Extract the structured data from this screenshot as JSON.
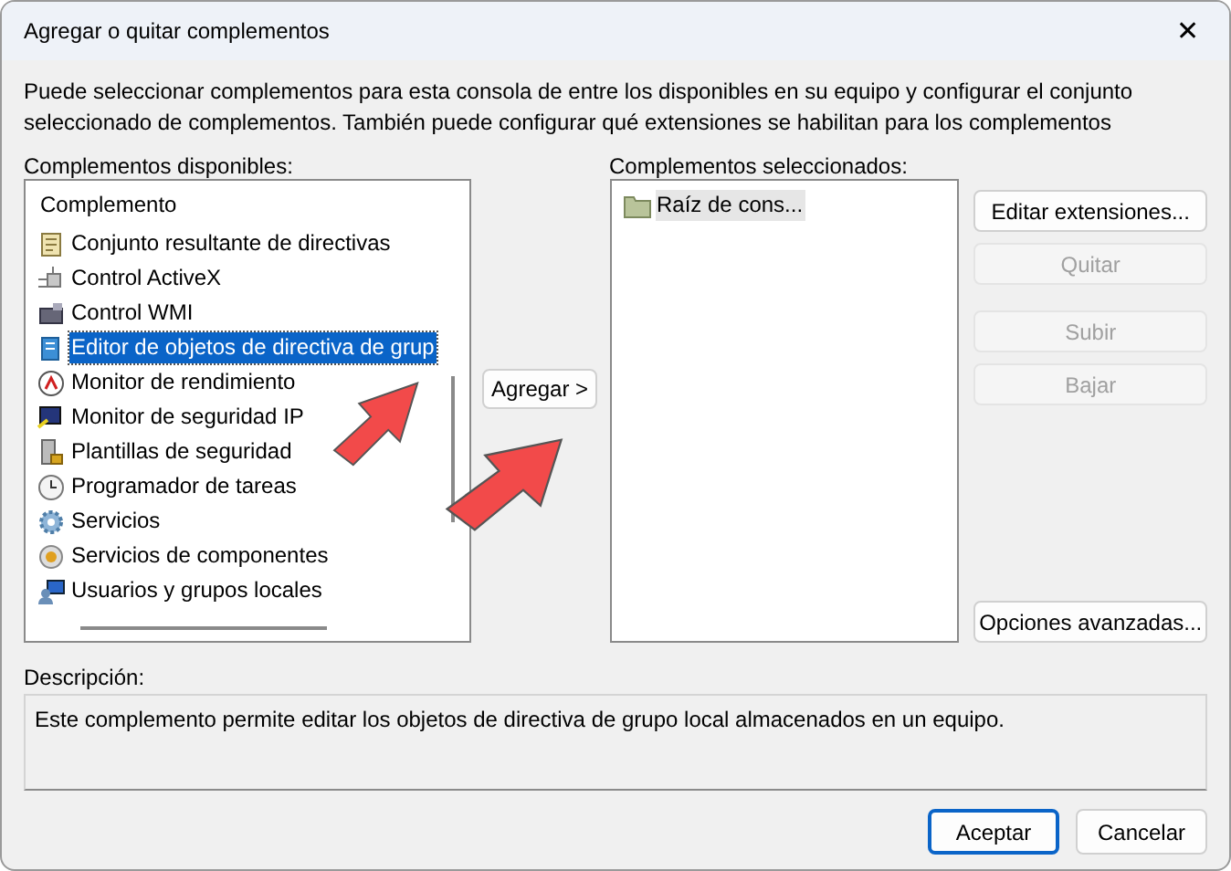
{
  "window": {
    "title": "Agregar o quitar complementos",
    "close": "✕"
  },
  "intro": "Puede seleccionar complementos para esta consola de entre los disponibles en su equipo y configurar el conjunto\nseleccionado de complementos. También puede configurar qué extensiones se habilitan para los complementos",
  "available": {
    "label": "Complementos disponibles:",
    "column": "Complemento",
    "items": [
      {
        "label": "Conjunto resultante de directivas",
        "selected": false
      },
      {
        "label": "Control ActiveX",
        "selected": false
      },
      {
        "label": "Control WMI",
        "selected": false
      },
      {
        "label": "Editor de objetos de directiva de grup",
        "selected": true
      },
      {
        "label": "Monitor de rendimiento",
        "selected": false
      },
      {
        "label": "Monitor de seguridad IP",
        "selected": false
      },
      {
        "label": "Plantillas de seguridad",
        "selected": false
      },
      {
        "label": "Programador de tareas",
        "selected": false
      },
      {
        "label": "Servicios",
        "selected": false
      },
      {
        "label": "Servicios de componentes",
        "selected": false
      },
      {
        "label": "Usuarios y grupos locales",
        "selected": false
      }
    ]
  },
  "add_button": "Agregar >",
  "selected_snapins": {
    "label": "Complementos seleccionados:",
    "items": [
      {
        "label": "Raíz de cons...",
        "selected": true
      }
    ]
  },
  "side_buttons": [
    {
      "label": "Editar extensiones...",
      "disabled": false
    },
    {
      "label": "Quitar",
      "disabled": true
    },
    {
      "label": "Subir",
      "disabled": true
    },
    {
      "label": "Bajar",
      "disabled": true
    },
    {
      "label": "Opciones avanzadas...",
      "disabled": false
    }
  ],
  "description": {
    "label": "Descripción:",
    "text": "Este complemento permite editar los objetos de directiva de grupo local almacenados en un equipo."
  },
  "footer_buttons": [
    {
      "label": "Aceptar",
      "default": true
    },
    {
      "label": "Cancelar",
      "default": false
    }
  ]
}
